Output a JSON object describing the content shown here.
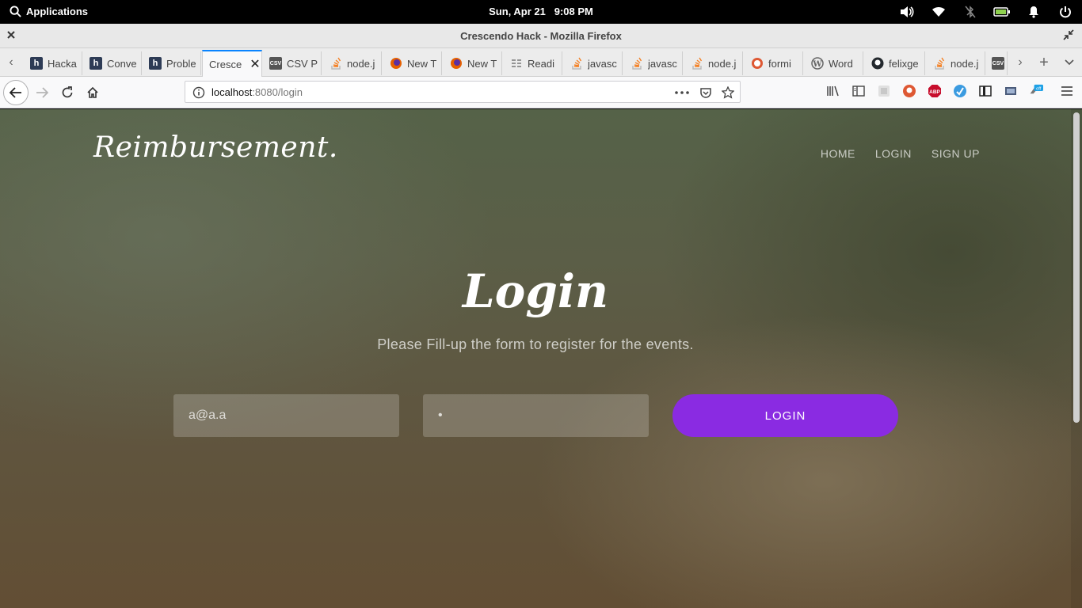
{
  "system": {
    "applications_label": "Applications",
    "datetime": "Sun, Apr 21",
    "time": "9:08 PM"
  },
  "window": {
    "title": "Crescendo Hack - Mozilla Firefox"
  },
  "tabs": [
    {
      "label": "Hacka",
      "favicon": "h"
    },
    {
      "label": "Conve",
      "favicon": "h"
    },
    {
      "label": "Proble",
      "favicon": "h"
    },
    {
      "label": "Cresce",
      "favicon": "",
      "active": true
    },
    {
      "label": "CSV P",
      "favicon": "csv"
    },
    {
      "label": "node.j",
      "favicon": "so"
    },
    {
      "label": "New T",
      "favicon": "ff"
    },
    {
      "label": "New T",
      "favicon": "ff"
    },
    {
      "label": "Readi",
      "favicon": "read"
    },
    {
      "label": "javasc",
      "favicon": "so"
    },
    {
      "label": "javasc",
      "favicon": "so"
    },
    {
      "label": "node.j",
      "favicon": "so"
    },
    {
      "label": "formi",
      "favicon": "ddg"
    },
    {
      "label": "Word",
      "favicon": "wp"
    },
    {
      "label": "felixge",
      "favicon": "gh"
    },
    {
      "label": "node.j",
      "favicon": "so"
    },
    {
      "label": "",
      "favicon": "csv"
    }
  ],
  "url": {
    "host": "localhost",
    "path": ":8080/login"
  },
  "page": {
    "brand": "Reimbursement.",
    "nav": {
      "home": "HOME",
      "login": "LOGIN",
      "signup": "SIGN UP"
    },
    "heading": "Login",
    "subtitle": "Please Fill-up the form to register for the events.",
    "form": {
      "email_value": "a@a.a",
      "password_value": "•",
      "submit_label": "LOGIN"
    }
  },
  "colors": {
    "accent": "#8a2be2",
    "tab_highlight": "#0a84ff"
  }
}
